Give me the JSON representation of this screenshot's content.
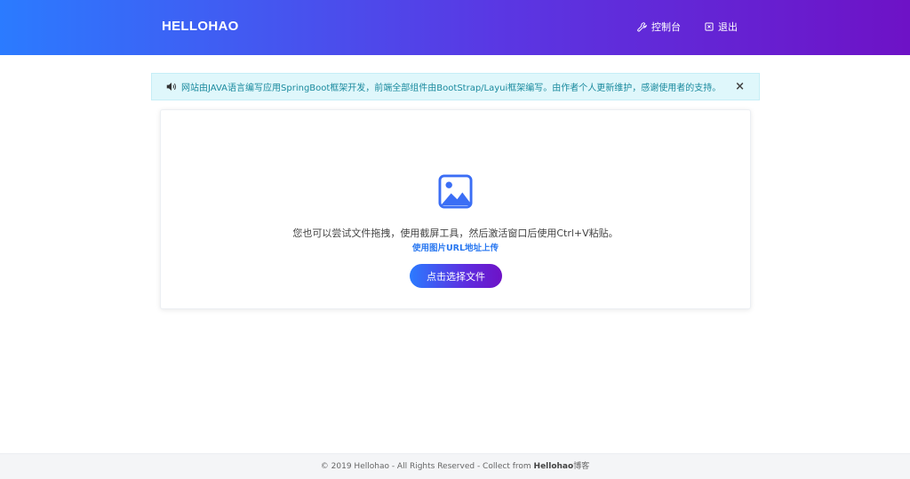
{
  "navbar": {
    "brand": "HELLOHAO",
    "console_label": "控制台",
    "logout_label": "退出",
    "console_icon": "wrench-icon",
    "logout_icon": "close-box-icon",
    "gradient": [
      "#2b7bff",
      "#5a37e3",
      "#6e12c6"
    ]
  },
  "alert": {
    "icon": "speaker-icon",
    "text": "网站由JAVA语言编写应用SpringBoot框架开发，前端全部组件由BootStrap/Layui框架编写。由作者个人更新维护，感谢使用者的支持。",
    "close": "×"
  },
  "upload": {
    "icon": "image-icon",
    "hint": "您也可以尝试文件拖拽，使用截屏工具，然后激活窗口后使用Ctrl+V粘贴。",
    "url_link": "使用图片URL地址上传",
    "button_label": "点击选择文件"
  },
  "footer": {
    "prefix": "© 2019 Hellohao - All Rights Reserved - Collect from ",
    "author": "Hellohao",
    "suffix": "博客"
  }
}
